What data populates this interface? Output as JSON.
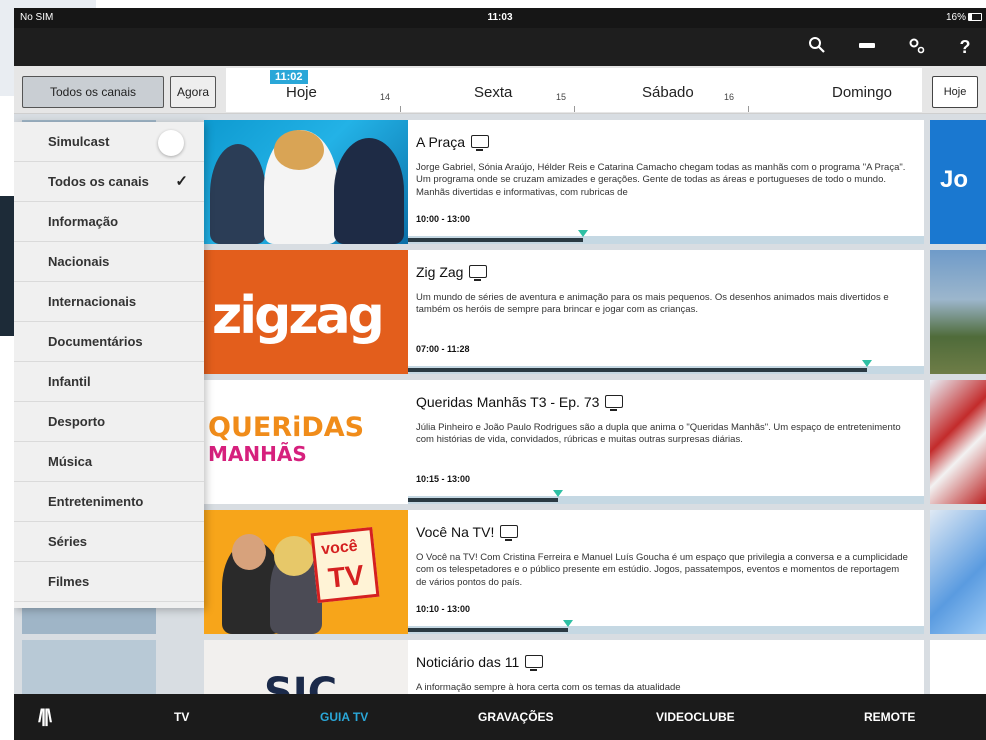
{
  "status_bar": {
    "carrier": "No SIM",
    "time": "11:03",
    "battery": "16%"
  },
  "toolbar": {
    "icons": [
      "search-icon",
      "minus-icon",
      "settings-icon",
      "help-icon"
    ],
    "help_glyph": "?"
  },
  "filter_button": "Todos os canais",
  "now_button": "Agora",
  "today_button": "Hoje",
  "now_time": "11:02",
  "days": [
    {
      "name": "Hoje",
      "num": "14"
    },
    {
      "name": "Sexta",
      "num": "15"
    },
    {
      "name": "Sábado",
      "num": "16"
    },
    {
      "name": "Domingo",
      "num": ""
    }
  ],
  "channel_menu": {
    "simulcast_label": "Simulcast",
    "items": [
      {
        "label": "Todos os canais",
        "checked": "✓"
      },
      {
        "label": "Informação"
      },
      {
        "label": "Nacionais"
      },
      {
        "label": "Internacionais"
      },
      {
        "label": "Documentários"
      },
      {
        "label": "Infantil"
      },
      {
        "label": "Desporto"
      },
      {
        "label": "Música"
      },
      {
        "label": "Entretenimento"
      },
      {
        "label": "Séries"
      },
      {
        "label": "Filmes"
      }
    ]
  },
  "programs": [
    {
      "title": "A Praça",
      "desc": "Jorge Gabriel, Sónia Araújo, Hélder Reis e Catarina Camacho chegam todas as manhãs com o programa \"A Praça\". Um programa onde se cruzam amizades e gerações. Gente de todas as áreas e portugueses de todo o mundo. Manhãs divertidas e informativas, com rubricas de",
      "time": "10:00 - 13:00",
      "progress": 0.34
    },
    {
      "title": "Zig Zag",
      "desc": "Um mundo de séries de aventura e animação para os mais pequenos. Os desenhos animados mais divertidos e também os heróis de sempre para brincar e jogar com as crianças.",
      "time": "07:00 - 11:28",
      "progress": 0.89,
      "logo": "zigzag"
    },
    {
      "title": "Queridas Manhãs T3 - Ep. 73",
      "desc": "Júlia Pinheiro e João Paulo Rodrigues são a dupla que anima o \"Queridas Manhãs\". Um espaço de entretenimento com histórias de vida, convidados, rúbricas e muitas outras surpresas diárias.",
      "time": "10:15 - 13:00",
      "progress": 0.29,
      "logo_l1": "QUERiDAS",
      "logo_l2": "MANHÃS"
    },
    {
      "title": "Você Na TV!",
      "desc": "O Você na TV! Com Cristina Ferreira e Manuel Luís Goucha é um espaço que privilegia a conversa e a cumplicidade com os telespetadores e o público presente em estúdio. Jogos, passatempos, eventos e momentos de reportagem de vários pontos do país.",
      "time": "10:10 - 13:00",
      "progress": 0.31,
      "logo_l1": "você",
      "logo_l2": "TV"
    },
    {
      "title": "Noticiário das 11",
      "desc": "A informação sempre à hora certa com os temas da atualidade",
      "time": "",
      "progress": 0,
      "logo": "SIC"
    }
  ],
  "right_tile_text": "Jo",
  "bottom_nav": {
    "logo": "/||\\",
    "items": [
      "TV",
      "GUIA TV",
      "GRAVAÇÕES",
      "VIDEOCLUBE",
      "REMOTE"
    ],
    "active": "GUIA TV"
  },
  "colors": {
    "accent": "#2aa7d8",
    "progress_marker": "#2fc0a4",
    "progress_track": "#c5d8e3"
  }
}
